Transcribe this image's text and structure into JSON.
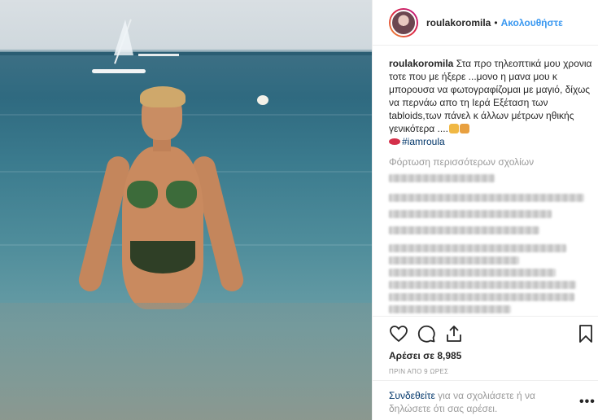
{
  "header": {
    "username": "roulakoromila",
    "separator": "•",
    "follow_label": "Ακολουθήστε"
  },
  "caption": {
    "username": "roulakoromila",
    "text": "Στα προ τηλεοπτικά μου χρονια τοτε που με ήξερε ...μονο η μανα μου κ μπορουσα να φωτογραφίζομαι με μαγιό, δίχως να περνάω απο τη Ιερά Εξέταση των tabloids,των πάνελ κ άλλων μέτρων ηθικής γενικότερα ....",
    "hashtag": "#iamroula"
  },
  "comments": {
    "load_more": "Φόρτωση περισσότερων σχολίων"
  },
  "actions": {
    "like_icon": "heart-icon",
    "comment_icon": "comment-icon",
    "share_icon": "share-icon",
    "save_icon": "bookmark-icon"
  },
  "stats": {
    "likes": "Αρέσει σε 8,985",
    "time": "ΠΡΙΝ ΑΠΟ 9 ΩΡΕΣ"
  },
  "footer": {
    "login_link": "Συνδεθείτε",
    "login_text": " για να σχολιάσετε ή να δηλώσετε ότι σας αρέσει.",
    "more_label": "•••"
  },
  "colors": {
    "link": "#3897f0",
    "text": "#262626",
    "muted": "#999999"
  }
}
